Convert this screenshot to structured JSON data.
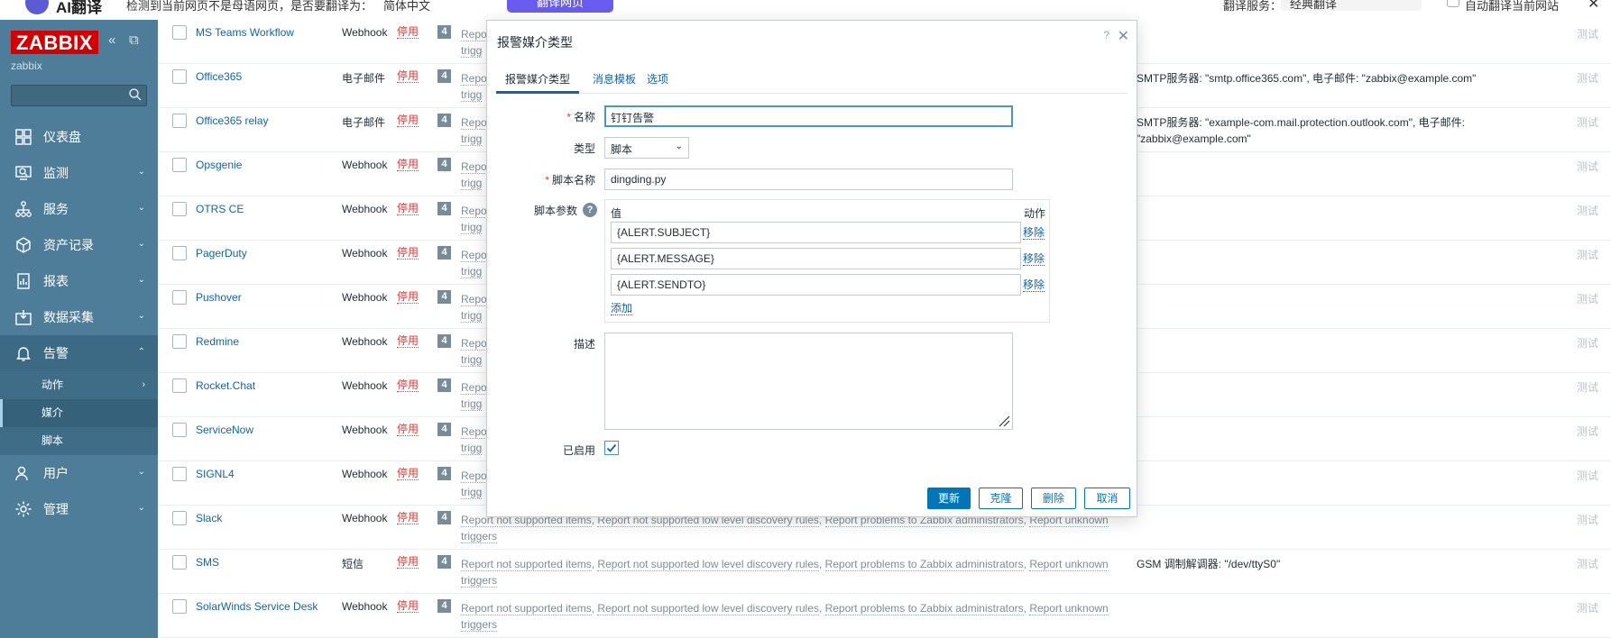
{
  "translator_bar": {
    "title": "AI翻译",
    "message": "检测到当前网页不是母语网页，是否要翻译为：",
    "target_lang": "简体中文",
    "translate_button": "翻译网页",
    "service_label": "翻译服务：",
    "service_value": "经典翻译",
    "auto_label": "自动翻译当前网站"
  },
  "sidebar": {
    "brand": "ZABBIX",
    "server_name": "zabbix",
    "search_placeholder": "",
    "items": [
      {
        "label": "仪表盘",
        "icon": "dashboard-icon",
        "has_chevron": false
      },
      {
        "label": "监测",
        "icon": "monitoring-icon",
        "has_chevron": true
      },
      {
        "label": "服务",
        "icon": "services-icon",
        "has_chevron": true
      },
      {
        "label": "资产记录",
        "icon": "inventory-icon",
        "has_chevron": true
      },
      {
        "label": "报表",
        "icon": "reports-icon",
        "has_chevron": true
      },
      {
        "label": "数据采集",
        "icon": "data-collection-icon",
        "has_chevron": true
      },
      {
        "label": "告警",
        "icon": "bell-icon",
        "has_chevron": true,
        "expanded": true
      },
      {
        "label": "用户",
        "icon": "users-icon",
        "has_chevron": true
      },
      {
        "label": "管理",
        "icon": "gear-icon",
        "has_chevron": true
      }
    ],
    "alerts_submenu": [
      {
        "label": "动作",
        "has_chevron": true
      },
      {
        "label": "媒介",
        "selected": true
      },
      {
        "label": "脚本"
      }
    ]
  },
  "media_rows": [
    {
      "name": "MS Teams Workflow",
      "type": "Webhook",
      "status": "停用",
      "count": "4",
      "details": ""
    },
    {
      "name": "Office365",
      "type": "电子邮件",
      "status": "停用",
      "count": "4",
      "details": "SMTP服务器: \"smtp.office365.com\", 电子邮件: \"zabbix@example.com\""
    },
    {
      "name": "Office365 relay",
      "type": "电子邮件",
      "status": "停用",
      "count": "4",
      "details": "SMTP服务器: \"example-com.mail.protection.outlook.com\", 电子邮件: \"zabbix@example.com\""
    },
    {
      "name": "Opsgenie",
      "type": "Webhook",
      "status": "停用",
      "count": "4",
      "details": ""
    },
    {
      "name": "OTRS CE",
      "type": "Webhook",
      "status": "停用",
      "count": "4",
      "details": ""
    },
    {
      "name": "PagerDuty",
      "type": "Webhook",
      "status": "停用",
      "count": "4",
      "details": ""
    },
    {
      "name": "Pushover",
      "type": "Webhook",
      "status": "停用",
      "count": "4",
      "details": ""
    },
    {
      "name": "Redmine",
      "type": "Webhook",
      "status": "停用",
      "count": "4",
      "details": ""
    },
    {
      "name": "Rocket.Chat",
      "type": "Webhook",
      "status": "停用",
      "count": "4",
      "details": ""
    },
    {
      "name": "ServiceNow",
      "type": "Webhook",
      "status": "停用",
      "count": "4",
      "details": ""
    },
    {
      "name": "SIGNL4",
      "type": "Webhook",
      "status": "停用",
      "count": "4",
      "details": ""
    },
    {
      "name": "Slack",
      "type": "Webhook",
      "status": "停用",
      "count": "4",
      "details": ""
    },
    {
      "name": "SMS",
      "type": "短信",
      "status": "停用",
      "count": "4",
      "details": "GSM 调制解调器: \"/dev/ttyS0\""
    },
    {
      "name": "SolarWinds Service Desk",
      "type": "Webhook",
      "status": "停用",
      "count": "4",
      "details": ""
    }
  ],
  "row_actions": {
    "a1": "Report not supported items",
    "a2": "Report not supported low level discovery rules",
    "a3": "Report problems to Zabbix administrators",
    "a4": "Report unknown",
    "a5": "triggers",
    "short": "Repo",
    "short2": "trigg"
  },
  "test_label": "测试",
  "modal": {
    "title": "报警媒介类型",
    "help": "?",
    "tabs": [
      "报警媒介类型",
      "消息模板",
      "选项"
    ],
    "fields": {
      "name_label": "名称",
      "name_value": "钉钉告警",
      "type_label": "类型",
      "type_value": "脚本",
      "script_name_label": "脚本名称",
      "script_name_value": "dingding.py",
      "script_params_label": "脚本参数",
      "params_col_value": "值",
      "params_col_action": "动作",
      "params": [
        "{ALERT.SUBJECT}",
        "{ALERT.MESSAGE}",
        "{ALERT.SENDTO}"
      ],
      "remove_label": "移除",
      "add_label": "添加",
      "description_label": "描述",
      "description_value": "",
      "enabled_label": "已启用",
      "enabled": true
    },
    "buttons": {
      "update": "更新",
      "clone": "克隆",
      "delete": "删除",
      "cancel": "取消"
    }
  },
  "colors": {
    "sidebar": "#4e7d99",
    "brand_red": "#d40000",
    "link": "#0f64a8",
    "disabled_red": "#e33734",
    "primary_button": "#0275b8"
  }
}
